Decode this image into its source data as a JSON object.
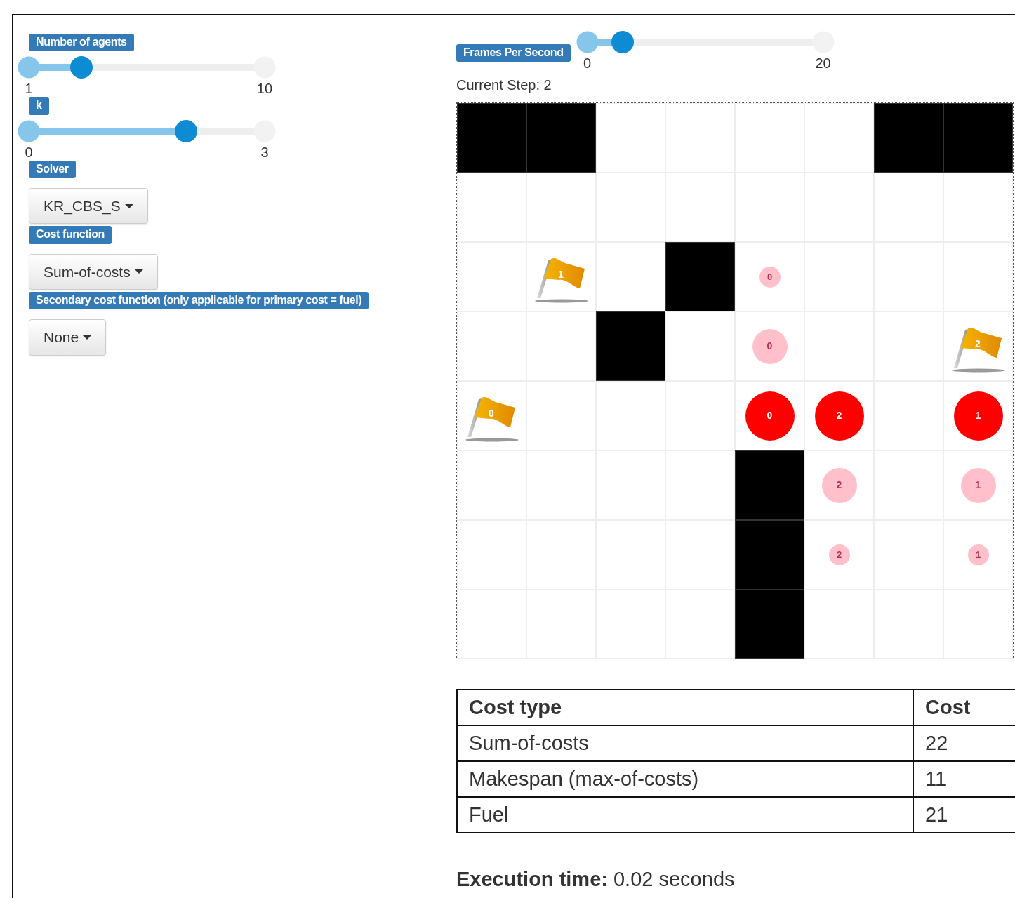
{
  "controls": [
    {
      "kind": "slider",
      "label": "Number of agents",
      "min": "1",
      "max": "10",
      "level": 0.222
    },
    {
      "kind": "slider",
      "label": "k",
      "min": "0",
      "max": "3",
      "level": 0.667
    },
    {
      "kind": "dropdown",
      "label": "Solver",
      "value": "KR_CBS_S"
    },
    {
      "kind": "dropdown",
      "label": "Cost function",
      "value": "Sum-of-costs"
    },
    {
      "kind": "dropdown",
      "label": "Secondary cost function (only applicable for primary cost = fuel)",
      "value": "None"
    }
  ],
  "playback": {
    "label": "Frames Per Second",
    "min": "0",
    "max": "20",
    "level": 0.15,
    "current_step": "Current Step: 2"
  },
  "grid": {
    "rows": [
      [
        {
          "kind": "obstacle"
        },
        {
          "kind": "obstacle"
        },
        {
          "kind": "empty"
        },
        {
          "kind": "empty"
        },
        {
          "kind": "empty"
        },
        {
          "kind": "empty"
        },
        {
          "kind": "obstacle"
        },
        {
          "kind": "obstacle"
        }
      ],
      [
        {
          "kind": "empty"
        },
        {
          "kind": "empty"
        },
        {
          "kind": "empty"
        },
        {
          "kind": "empty"
        },
        {
          "kind": "empty"
        },
        {
          "kind": "empty"
        },
        {
          "kind": "empty"
        },
        {
          "kind": "empty"
        }
      ],
      [
        {
          "kind": "empty"
        },
        {
          "kind": "goal",
          "label": "1"
        },
        {
          "kind": "empty"
        },
        {
          "kind": "obstacle"
        },
        {
          "kind": "start",
          "label": "0"
        },
        {
          "kind": "empty"
        },
        {
          "kind": "empty"
        },
        {
          "kind": "empty"
        }
      ],
      [
        {
          "kind": "empty"
        },
        {
          "kind": "empty"
        },
        {
          "kind": "obstacle"
        },
        {
          "kind": "empty"
        },
        {
          "kind": "previous",
          "label": "0"
        },
        {
          "kind": "empty"
        },
        {
          "kind": "empty"
        },
        {
          "kind": "goal",
          "label": "2"
        }
      ],
      [
        {
          "kind": "goal",
          "label": "0"
        },
        {
          "kind": "empty"
        },
        {
          "kind": "empty"
        },
        {
          "kind": "empty"
        },
        {
          "kind": "agent",
          "label": "0"
        },
        {
          "kind": "agent",
          "label": "2"
        },
        {
          "kind": "empty"
        },
        {
          "kind": "agent",
          "label": "1"
        }
      ],
      [
        {
          "kind": "empty"
        },
        {
          "kind": "empty"
        },
        {
          "kind": "empty"
        },
        {
          "kind": "empty"
        },
        {
          "kind": "obstacle"
        },
        {
          "kind": "previous",
          "label": "2"
        },
        {
          "kind": "empty"
        },
        {
          "kind": "previous",
          "label": "1"
        }
      ],
      [
        {
          "kind": "empty"
        },
        {
          "kind": "empty"
        },
        {
          "kind": "empty"
        },
        {
          "kind": "empty"
        },
        {
          "kind": "obstacle"
        },
        {
          "kind": "start",
          "label": "2"
        },
        {
          "kind": "empty"
        },
        {
          "kind": "start",
          "label": "1"
        }
      ],
      [
        {
          "kind": "empty"
        },
        {
          "kind": "empty"
        },
        {
          "kind": "empty"
        },
        {
          "kind": "empty"
        },
        {
          "kind": "obstacle"
        },
        {
          "kind": "empty"
        },
        {
          "kind": "empty"
        },
        {
          "kind": "empty"
        }
      ]
    ]
  },
  "cost_table": {
    "columns": [
      "Cost type",
      "Cost"
    ],
    "rows": [
      [
        "Sum-of-costs",
        "22"
      ],
      [
        "Makespan (max-of-costs)",
        "11"
      ],
      [
        "Fuel",
        "21"
      ]
    ]
  },
  "execution_time": "**Execution time:** 0.02 seconds"
}
